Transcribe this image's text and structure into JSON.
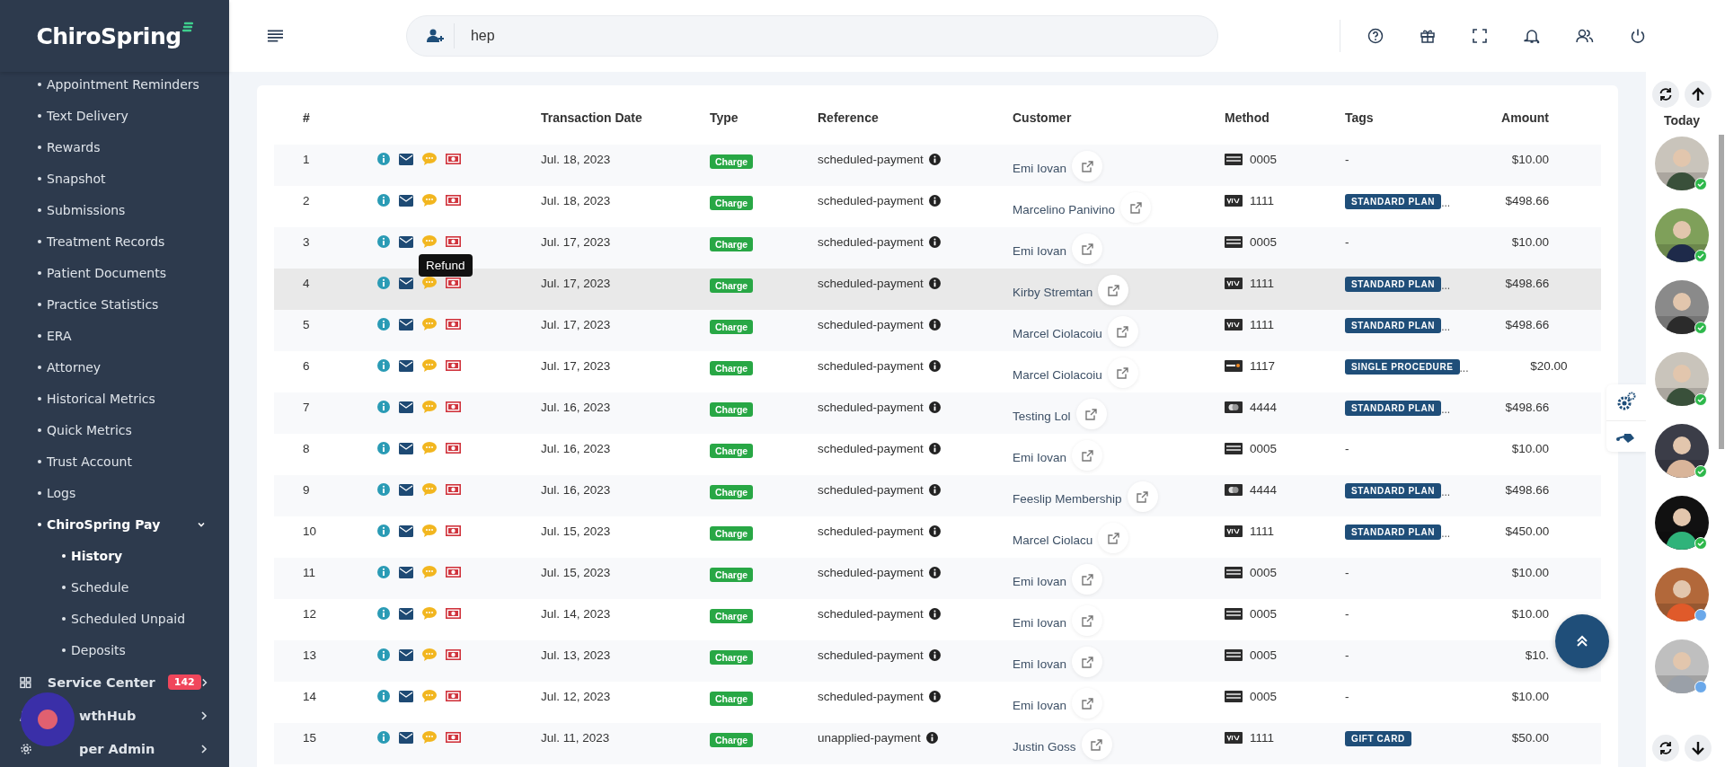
{
  "logo": "ChiroSpring",
  "sidebar": {
    "items": [
      {
        "label": "Appointment Reminders",
        "selected": false
      },
      {
        "label": "Text Delivery",
        "selected": false
      },
      {
        "label": "Rewards",
        "selected": false
      },
      {
        "label": "Snapshot",
        "selected": false
      },
      {
        "label": "Submissions",
        "selected": false
      },
      {
        "label": "Treatment Records",
        "selected": false
      },
      {
        "label": "Patient Documents",
        "selected": false
      },
      {
        "label": "Practice Statistics",
        "selected": false
      },
      {
        "label": "ERA",
        "selected": false
      },
      {
        "label": "Attorney",
        "selected": false
      },
      {
        "label": "Historical Metrics",
        "selected": false
      },
      {
        "label": "Quick Metrics",
        "selected": false
      },
      {
        "label": "Trust Account",
        "selected": false
      },
      {
        "label": "Logs",
        "selected": false
      },
      {
        "label": "ChiroSpring Pay",
        "selected": true,
        "expanded": true,
        "children": [
          {
            "label": "History",
            "selected": true
          },
          {
            "label": "Schedule",
            "selected": false
          },
          {
            "label": "Scheduled Unpaid",
            "selected": false
          },
          {
            "label": "Deposits",
            "selected": false
          }
        ]
      }
    ],
    "sections": [
      {
        "kind": "grid",
        "label": "Service Center",
        "badge": "142"
      },
      {
        "kind": "person",
        "label": "wthHub"
      },
      {
        "kind": "gear",
        "label": "per Admin"
      }
    ]
  },
  "search": {
    "value": "hep"
  },
  "table": {
    "columns": [
      "#",
      "Transaction Date",
      "Type",
      "Reference",
      "Customer",
      "Method",
      "Tags",
      "Amount"
    ],
    "rows": [
      {
        "num": "1",
        "date": "Jul. 18, 2023",
        "type": "Charge",
        "reference": "scheduled-payment",
        "customer": "Emi Iovan",
        "method": {
          "kind": "amex",
          "last4": "0005"
        },
        "tag": {
          "kind": "none",
          "label": "-"
        },
        "amount": "$10.00",
        "highlighted": false
      },
      {
        "num": "2",
        "date": "Jul. 18, 2023",
        "type": "Charge",
        "reference": "scheduled-payment",
        "customer": "Marcelino Panivino",
        "method": {
          "kind": "visa",
          "last4": "1111"
        },
        "tag": {
          "kind": "badge",
          "label": "STANDARD PLAN",
          "more": "..."
        },
        "amount": "$498.66",
        "highlighted": false
      },
      {
        "num": "3",
        "date": "Jul. 17, 2023",
        "type": "Charge",
        "reference": "scheduled-payment",
        "customer": "Emi Iovan",
        "method": {
          "kind": "amex",
          "last4": "0005"
        },
        "tag": {
          "kind": "none",
          "label": "-"
        },
        "amount": "$10.00",
        "highlighted": false,
        "tooltip": "Refund"
      },
      {
        "num": "4",
        "date": "Jul. 17, 2023",
        "type": "Charge",
        "reference": "scheduled-payment",
        "customer": "Kirby Stremtan",
        "method": {
          "kind": "visa",
          "last4": "1111"
        },
        "tag": {
          "kind": "badge",
          "label": "STANDARD PLAN",
          "more": "..."
        },
        "amount": "$498.66",
        "highlighted": true
      },
      {
        "num": "5",
        "date": "Jul. 17, 2023",
        "type": "Charge",
        "reference": "scheduled-payment",
        "customer": "Marcel Ciolacoiu",
        "method": {
          "kind": "visa",
          "last4": "1111"
        },
        "tag": {
          "kind": "badge",
          "label": "STANDARD PLAN",
          "more": "..."
        },
        "amount": "$498.66",
        "highlighted": false
      },
      {
        "num": "6",
        "date": "Jul. 17, 2023",
        "type": "Charge",
        "reference": "scheduled-payment",
        "customer": "Marcel Ciolacoiu",
        "method": {
          "kind": "discover",
          "last4": "1117"
        },
        "tag": {
          "kind": "badge",
          "label": "SINGLE PROCEDURE",
          "more": "..."
        },
        "amount": "$20.00",
        "highlighted": false
      },
      {
        "num": "7",
        "date": "Jul. 16, 2023",
        "type": "Charge",
        "reference": "scheduled-payment",
        "customer": "Testing Lol",
        "method": {
          "kind": "mastercard",
          "last4": "4444"
        },
        "tag": {
          "kind": "badge",
          "label": "STANDARD PLAN",
          "more": "..."
        },
        "amount": "$498.66",
        "highlighted": false
      },
      {
        "num": "8",
        "date": "Jul. 16, 2023",
        "type": "Charge",
        "reference": "scheduled-payment",
        "customer": "Emi Iovan",
        "method": {
          "kind": "amex",
          "last4": "0005"
        },
        "tag": {
          "kind": "none",
          "label": "-"
        },
        "amount": "$10.00",
        "highlighted": false
      },
      {
        "num": "9",
        "date": "Jul. 16, 2023",
        "type": "Charge",
        "reference": "scheduled-payment",
        "customer": "Feeslip Membership",
        "method": {
          "kind": "mastercard",
          "last4": "4444"
        },
        "tag": {
          "kind": "badge",
          "label": "STANDARD PLAN",
          "more": "..."
        },
        "amount": "$498.66",
        "highlighted": false
      },
      {
        "num": "10",
        "date": "Jul. 15, 2023",
        "type": "Charge",
        "reference": "scheduled-payment",
        "customer": "Marcel Ciolacu",
        "method": {
          "kind": "visa",
          "last4": "1111"
        },
        "tag": {
          "kind": "badge",
          "label": "STANDARD PLAN",
          "more": "..."
        },
        "amount": "$450.00",
        "highlighted": false
      },
      {
        "num": "11",
        "date": "Jul. 15, 2023",
        "type": "Charge",
        "reference": "scheduled-payment",
        "customer": "Emi Iovan",
        "method": {
          "kind": "amex",
          "last4": "0005"
        },
        "tag": {
          "kind": "none",
          "label": "-"
        },
        "amount": "$10.00",
        "highlighted": false
      },
      {
        "num": "12",
        "date": "Jul. 14, 2023",
        "type": "Charge",
        "reference": "scheduled-payment",
        "customer": "Emi Iovan",
        "method": {
          "kind": "amex",
          "last4": "0005"
        },
        "tag": {
          "kind": "none",
          "label": "-"
        },
        "amount": "$10.00",
        "highlighted": false
      },
      {
        "num": "13",
        "date": "Jul. 13, 2023",
        "type": "Charge",
        "reference": "scheduled-payment",
        "customer": "Emi Iovan",
        "method": {
          "kind": "amex",
          "last4": "0005"
        },
        "tag": {
          "kind": "none",
          "label": "-"
        },
        "amount": "$10.",
        "highlighted": false
      },
      {
        "num": "14",
        "date": "Jul. 12, 2023",
        "type": "Charge",
        "reference": "scheduled-payment",
        "customer": "Emi Iovan",
        "method": {
          "kind": "amex",
          "last4": "0005"
        },
        "tag": {
          "kind": "none",
          "label": "-"
        },
        "amount": "$10.00",
        "highlighted": false
      },
      {
        "num": "15",
        "date": "Jul. 11, 2023",
        "type": "Charge",
        "reference": "unapplied-payment",
        "customer": "Justin Goss",
        "method": {
          "kind": "visa",
          "last4": "1111"
        },
        "tag": {
          "kind": "badge",
          "label": "GIFT CARD"
        },
        "amount": "$50.00",
        "highlighted": false
      }
    ]
  },
  "feed": {
    "title": "Today",
    "avatars": [
      {
        "kind": "picture",
        "verified": true
      },
      {
        "kind": "picture",
        "verified": true
      },
      {
        "kind": "picture",
        "verified": true
      },
      {
        "kind": "picture",
        "verified": true
      },
      {
        "kind": "picture",
        "verified": true
      },
      {
        "kind": "picture",
        "verified": true
      },
      {
        "kind": "picture",
        "verified": false
      },
      {
        "kind": "picture",
        "verified": false
      }
    ]
  }
}
